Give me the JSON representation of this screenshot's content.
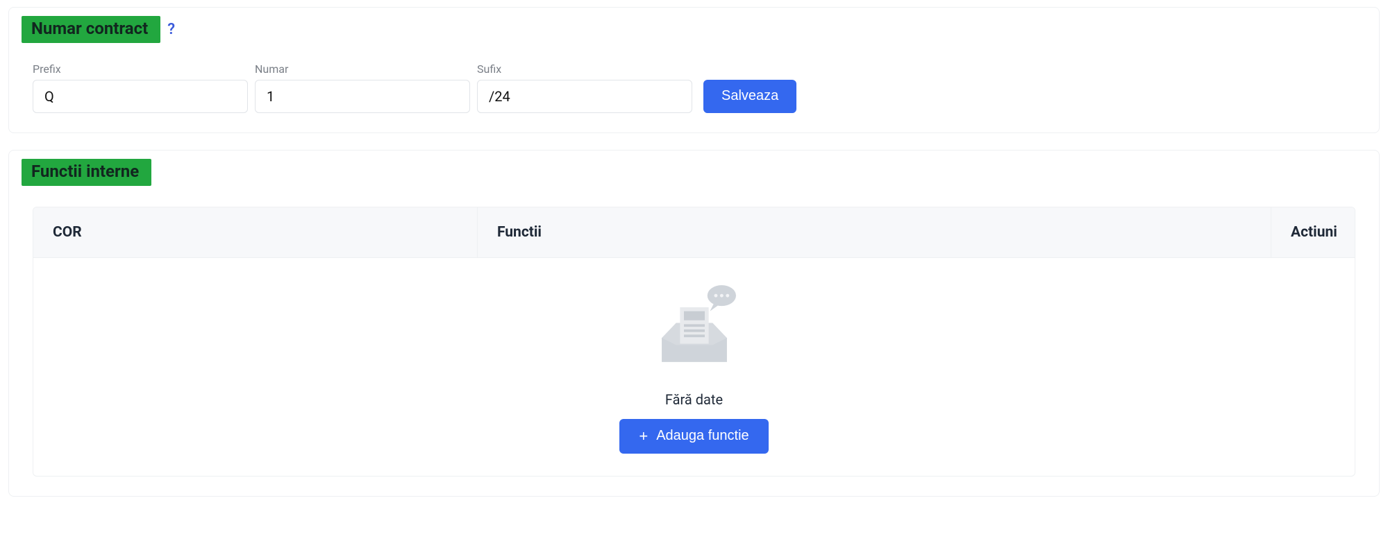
{
  "contract": {
    "title": "Numar contract",
    "help_icon": "?",
    "fields": {
      "prefix": {
        "label": "Prefix",
        "value": "Q"
      },
      "numar": {
        "label": "Numar",
        "value": "1"
      },
      "sufix": {
        "label": "Sufix",
        "value": "/24"
      }
    },
    "save_label": "Salveaza"
  },
  "functii": {
    "title": "Functii interne",
    "columns": {
      "cor": "COR",
      "functii": "Functii",
      "actiuni": "Actiuni"
    },
    "empty_text": "Fără date",
    "add_label": "Adauga functie",
    "add_icon": "+"
  }
}
